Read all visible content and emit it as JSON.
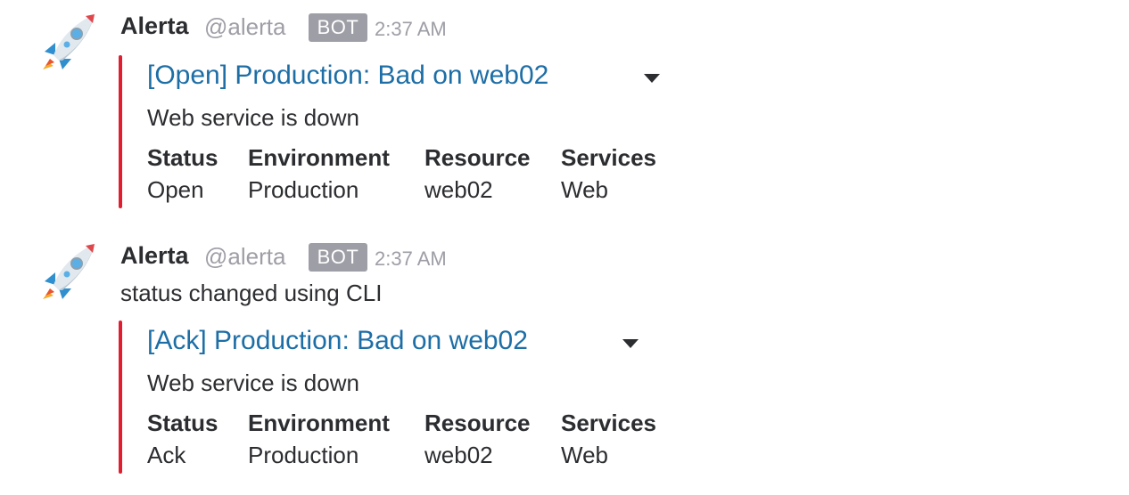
{
  "messages": [
    {
      "avatar_icon": "rocket-icon",
      "username": "Alerta",
      "handle": "@alerta",
      "badge": "BOT",
      "time": "2:37 AM",
      "text": "",
      "attachment": {
        "color": "#e01e2f",
        "title": "[Open] Production: Bad on web02",
        "text": "Web service is down",
        "fields": [
          {
            "title": "Status",
            "value": "Open"
          },
          {
            "title": "Environment",
            "value": "Production"
          },
          {
            "title": "Resource",
            "value": "web02"
          },
          {
            "title": "Services",
            "value": "Web"
          }
        ]
      }
    },
    {
      "avatar_icon": "rocket-icon",
      "username": "Alerta",
      "handle": "@alerta",
      "badge": "BOT",
      "time": "2:37 AM",
      "text": "status changed using CLI",
      "attachment": {
        "color": "#e01e2f",
        "title": "[Ack] Production: Bad on web02",
        "text": "Web service is down",
        "fields": [
          {
            "title": "Status",
            "value": "Ack"
          },
          {
            "title": "Environment",
            "value": "Production"
          },
          {
            "title": "Resource",
            "value": "web02"
          },
          {
            "title": "Services",
            "value": "Web"
          }
        ]
      }
    }
  ]
}
